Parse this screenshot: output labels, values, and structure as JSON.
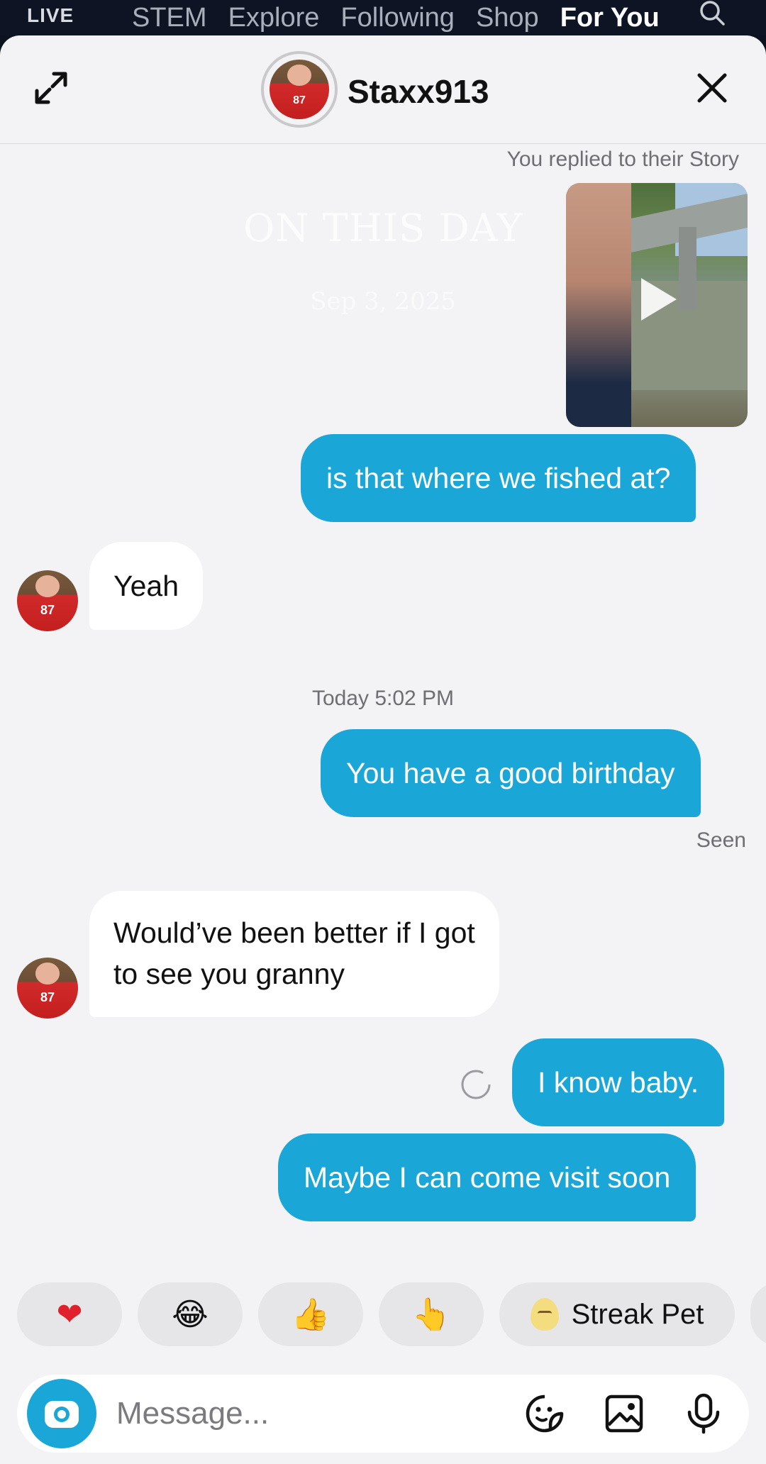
{
  "top_nav": {
    "live": "LIVE",
    "tabs": [
      {
        "label": "STEM",
        "active": false
      },
      {
        "label": "Explore",
        "active": false
      },
      {
        "label": "Following",
        "active": false
      },
      {
        "label": "Shop",
        "active": false
      },
      {
        "label": "For You",
        "active": true
      }
    ]
  },
  "header": {
    "username": "Staxx913",
    "avatar_jersey_number": "87"
  },
  "story": {
    "label": "You replied to their Story",
    "overlay_title": "ON THIS DAY",
    "overlay_date": "Sep 3, 2025"
  },
  "messages": [
    {
      "from": "me",
      "text": "is that where we fished at?"
    },
    {
      "from": "them",
      "text": "Yeah"
    },
    {
      "type": "timestamp",
      "text": "Today 5:02 PM"
    },
    {
      "from": "me",
      "text": "You have a good birthday",
      "status": "Seen"
    },
    {
      "from": "them",
      "lines": [
        "Would’ve been better if I got",
        "to see you granny"
      ]
    },
    {
      "from": "me",
      "text": "I know baby.",
      "sending": true
    },
    {
      "from": "me",
      "text": "Maybe I can come visit soon"
    }
  ],
  "reactions": [
    {
      "icon": "heart",
      "glyph": "❤"
    },
    {
      "icon": "laughing-face",
      "glyph": "😂"
    },
    {
      "icon": "thumbs-up",
      "glyph": "👍"
    },
    {
      "icon": "pointing-hand",
      "glyph": "👆"
    },
    {
      "icon": "streak-pet-egg",
      "label": "Streak Pet"
    }
  ],
  "composer": {
    "placeholder": "Message..."
  },
  "colors": {
    "outgoing_bubble": "#1aa7d8",
    "incoming_bubble": "#ffffff",
    "sheet_background": "#f3f3f5",
    "camera_button": "#1aa7d8"
  }
}
